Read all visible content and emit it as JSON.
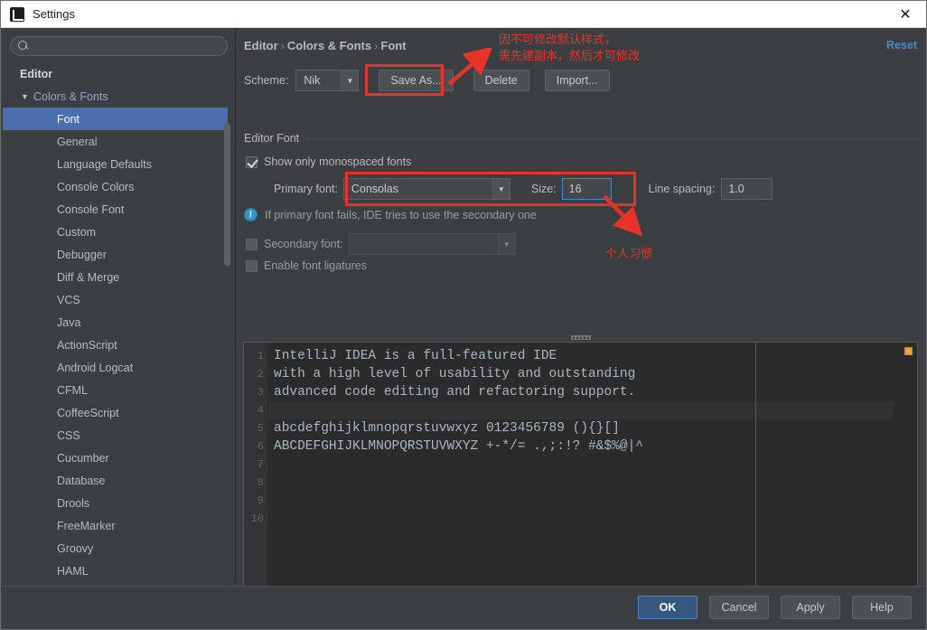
{
  "window": {
    "title": "Settings",
    "close_label": "✕",
    "app_icon": "intellij-idea-icon"
  },
  "sidebar": {
    "search_placeholder": "",
    "search_value": "",
    "scrollbar": "vertical-scrollbar",
    "items": [
      {
        "label": "Editor",
        "level": 0,
        "selected": false,
        "caret": ""
      },
      {
        "label": "Colors & Fonts",
        "level": 1,
        "selected": false,
        "caret": "▼"
      },
      {
        "label": "Font",
        "level": 2,
        "selected": true,
        "caret": ""
      },
      {
        "label": "General",
        "level": 2,
        "selected": false,
        "caret": ""
      },
      {
        "label": "Language Defaults",
        "level": 2,
        "selected": false,
        "caret": ""
      },
      {
        "label": "Console Colors",
        "level": 2,
        "selected": false,
        "caret": ""
      },
      {
        "label": "Console Font",
        "level": 2,
        "selected": false,
        "caret": ""
      },
      {
        "label": "Custom",
        "level": 2,
        "selected": false,
        "caret": ""
      },
      {
        "label": "Debugger",
        "level": 2,
        "selected": false,
        "caret": ""
      },
      {
        "label": "Diff & Merge",
        "level": 2,
        "selected": false,
        "caret": ""
      },
      {
        "label": "VCS",
        "level": 2,
        "selected": false,
        "caret": ""
      },
      {
        "label": "Java",
        "level": 2,
        "selected": false,
        "caret": ""
      },
      {
        "label": "ActionScript",
        "level": 2,
        "selected": false,
        "caret": ""
      },
      {
        "label": "Android Logcat",
        "level": 2,
        "selected": false,
        "caret": ""
      },
      {
        "label": "CFML",
        "level": 2,
        "selected": false,
        "caret": ""
      },
      {
        "label": "CoffeeScript",
        "level": 2,
        "selected": false,
        "caret": ""
      },
      {
        "label": "CSS",
        "level": 2,
        "selected": false,
        "caret": ""
      },
      {
        "label": "Cucumber",
        "level": 2,
        "selected": false,
        "caret": ""
      },
      {
        "label": "Database",
        "level": 2,
        "selected": false,
        "caret": ""
      },
      {
        "label": "Drools",
        "level": 2,
        "selected": false,
        "caret": ""
      },
      {
        "label": "FreeMarker",
        "level": 2,
        "selected": false,
        "caret": ""
      },
      {
        "label": "Groovy",
        "level": 2,
        "selected": false,
        "caret": ""
      },
      {
        "label": "HAML",
        "level": 2,
        "selected": false,
        "caret": ""
      }
    ]
  },
  "main": {
    "breadcrumb": {
      "part1": "Editor",
      "sep1": "›",
      "part2": "Colors & Fonts",
      "sep2": "›",
      "part3": "Font"
    },
    "reset_label": "Reset",
    "scheme": {
      "label": "Scheme:",
      "value": "Nik",
      "dropdown_arrow": "▼",
      "save_as_label": "Save As...",
      "delete_label": "Delete",
      "import_label": "Import..."
    },
    "editor_font": {
      "group_title": "Editor Font",
      "show_monospaced_label": "Show only monospaced fonts",
      "show_monospaced_checked": true,
      "primary_font_label": "Primary font:",
      "primary_font_value": "Consolas",
      "primary_font_arrow": "▼",
      "size_label": "Size:",
      "size_value": "16",
      "line_spacing_label": "Line spacing:",
      "line_spacing_value": "1.0",
      "info_icon_glyph": "!",
      "info_text": "If primary font fails, IDE tries to use the secondary one",
      "secondary_font_label": "Secondary font:",
      "secondary_font_value": "",
      "secondary_font_arrow": "▼",
      "secondary_font_checked": false,
      "ligatures_label": "Enable font ligatures",
      "ligatures_checked": false
    },
    "annotations": {
      "scheme_note": "因不可修改默认样式，\n需先建副本，然后才可修改",
      "font_note": "个人习惯",
      "highlight_color": "#e8332a"
    },
    "preview": {
      "line_numbers": [
        "1",
        "2",
        "3",
        "4",
        "5",
        "6",
        "7",
        "8",
        "9",
        "10"
      ],
      "lines": [
        "IntelliJ IDEA is a full-featured IDE",
        "with a high level of usability and outstanding",
        "advanced code editing and refactoring support.",
        "",
        "abcdefghijklmnopqrstuvwxyz 0123456789 (){}[]",
        "ABCDEFGHIJKLMNOPQRSTUVWXYZ +-*/= .,;:!? #&$%@|^",
        "",
        "",
        "",
        ""
      ],
      "marker_color": "#e8a33d"
    }
  },
  "footer": {
    "ok_label": "OK",
    "cancel_label": "Cancel",
    "apply_label": "Apply",
    "help_label": "Help"
  }
}
